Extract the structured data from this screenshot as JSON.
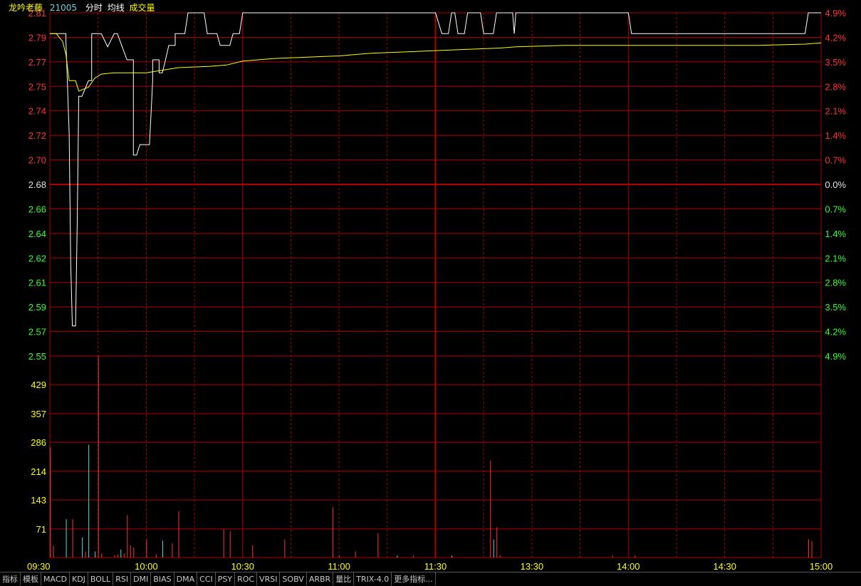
{
  "header": {
    "stock_name": "龙吟老藤",
    "stock_code": "21005",
    "indicator_labels": [
      "分时",
      "均线",
      "成交量"
    ]
  },
  "colors": {
    "up": "#ff3232",
    "down": "#33ff33",
    "flat": "#e0e0e0",
    "price_line": "#ffffff",
    "avg_line": "#ffff00",
    "volume_tick": "#ffff00",
    "cyan": "#5fd7d7",
    "time_label": "#ffff00"
  },
  "chart_data": {
    "type": "line",
    "prev_close": 2.68,
    "ylim": [
      2.549,
      2.812
    ],
    "price_ticks": [
      "2.81",
      "2.79",
      "2.77",
      "2.75",
      "2.74",
      "2.72",
      "2.70",
      "2.68",
      "2.66",
      "2.64",
      "2.62",
      "2.61",
      "2.59",
      "2.57",
      "2.55"
    ],
    "pct_ticks": [
      "4.9%",
      "4.2%",
      "3.5%",
      "2.8%",
      "2.1%",
      "1.4%",
      "0.7%",
      "0.0%",
      "0.7%",
      "1.4%",
      "2.1%",
      "2.8%",
      "3.5%",
      "4.2%",
      "4.9%"
    ],
    "x_labels": [
      "09:30",
      "10:00",
      "10:30",
      "11:00",
      "11:30",
      "13:30",
      "14:00",
      "14:30",
      "15:00"
    ],
    "x_label_minutes": [
      0,
      30,
      60,
      90,
      120,
      150,
      180,
      210,
      240
    ],
    "series": [
      {
        "role": "price",
        "points": [
          [
            0,
            2.796
          ],
          [
            5,
            2.796
          ],
          [
            5,
            2.79
          ],
          [
            6,
            2.72
          ],
          [
            6.5,
            2.62
          ],
          [
            7,
            2.572
          ],
          [
            8,
            2.572
          ],
          [
            8.5,
            2.65
          ],
          [
            9,
            2.748
          ],
          [
            10,
            2.748
          ],
          [
            12,
            2.76
          ],
          [
            13,
            2.76
          ],
          [
            13,
            2.796
          ],
          [
            16,
            2.796
          ],
          [
            18,
            2.786
          ],
          [
            20,
            2.796
          ],
          [
            21,
            2.796
          ],
          [
            24,
            2.776
          ],
          [
            25,
            2.776
          ],
          [
            26,
            2.776
          ],
          [
            26,
            2.703
          ],
          [
            27,
            2.703
          ],
          [
            28,
            2.711
          ],
          [
            31,
            2.711
          ],
          [
            32,
            2.76
          ],
          [
            32,
            2.776
          ],
          [
            34,
            2.776
          ],
          [
            34,
            2.766
          ],
          [
            35,
            2.766
          ],
          [
            36,
            2.776
          ],
          [
            37,
            2.787
          ],
          [
            39,
            2.787
          ],
          [
            39,
            2.796
          ],
          [
            41,
            2.796
          ],
          [
            42,
            2.796
          ],
          [
            43,
            2.812
          ],
          [
            44,
            2.812
          ],
          [
            48,
            2.812
          ],
          [
            49,
            2.796
          ],
          [
            52,
            2.796
          ],
          [
            53,
            2.787
          ],
          [
            56,
            2.787
          ],
          [
            57,
            2.796
          ],
          [
            59,
            2.796
          ],
          [
            60,
            2.812
          ],
          [
            120,
            2.812
          ],
          [
            122,
            2.796
          ],
          [
            124,
            2.796
          ],
          [
            125,
            2.812
          ],
          [
            126,
            2.812
          ],
          [
            127,
            2.796
          ],
          [
            129,
            2.796
          ],
          [
            130,
            2.812
          ],
          [
            134,
            2.812
          ],
          [
            135,
            2.796
          ],
          [
            138,
            2.796
          ],
          [
            139,
            2.812
          ],
          [
            144,
            2.812
          ],
          [
            144.5,
            2.796
          ],
          [
            145,
            2.812
          ],
          [
            180,
            2.812
          ],
          [
            181,
            2.796
          ],
          [
            235,
            2.796
          ],
          [
            236,
            2.812
          ],
          [
            240,
            2.812
          ]
        ]
      },
      {
        "role": "average",
        "points": [
          [
            0,
            2.796
          ],
          [
            2,
            2.796
          ],
          [
            4,
            2.79
          ],
          [
            5,
            2.78
          ],
          [
            6,
            2.76
          ],
          [
            8,
            2.76
          ],
          [
            9,
            2.752
          ],
          [
            12,
            2.755
          ],
          [
            14,
            2.762
          ],
          [
            16,
            2.765
          ],
          [
            20,
            2.766
          ],
          [
            24,
            2.766
          ],
          [
            30,
            2.766
          ],
          [
            35,
            2.768
          ],
          [
            40,
            2.77
          ],
          [
            50,
            2.771
          ],
          [
            55,
            2.772
          ],
          [
            60,
            2.775
          ],
          [
            70,
            2.777
          ],
          [
            80,
            2.778
          ],
          [
            90,
            2.779
          ],
          [
            100,
            2.781
          ],
          [
            110,
            2.782
          ],
          [
            120,
            2.783
          ],
          [
            140,
            2.785
          ],
          [
            145,
            2.786
          ],
          [
            160,
            2.787
          ],
          [
            180,
            2.787
          ],
          [
            200,
            2.787
          ],
          [
            220,
            2.787
          ],
          [
            235,
            2.788
          ],
          [
            240,
            2.789
          ]
        ]
      }
    ],
    "volume_ticks": [
      "429",
      "357",
      "286",
      "214",
      "143",
      "71"
    ],
    "volume_ylim": [
      0,
      500
    ],
    "volume": [
      [
        0,
        274,
        "up"
      ],
      [
        1,
        30,
        "up"
      ],
      [
        5,
        95,
        "down"
      ],
      [
        7,
        95,
        "up"
      ],
      [
        10,
        50,
        "down"
      ],
      [
        11,
        15,
        "up"
      ],
      [
        12,
        280,
        "down"
      ],
      [
        14,
        15,
        "down"
      ],
      [
        15,
        500,
        "up"
      ],
      [
        16,
        10,
        "up"
      ],
      [
        20,
        5,
        "up"
      ],
      [
        21,
        8,
        "up"
      ],
      [
        22,
        20,
        "down"
      ],
      [
        23,
        10,
        "up"
      ],
      [
        24,
        105,
        "up"
      ],
      [
        25,
        30,
        "up"
      ],
      [
        26,
        25,
        "up"
      ],
      [
        30,
        45,
        "up"
      ],
      [
        33,
        8,
        "up"
      ],
      [
        35,
        42,
        "down"
      ],
      [
        38,
        35,
        "up"
      ],
      [
        40,
        115,
        "up"
      ],
      [
        54,
        70,
        "up"
      ],
      [
        56,
        65,
        "up"
      ],
      [
        63,
        30,
        "up"
      ],
      [
        73,
        45,
        "up"
      ],
      [
        88,
        125,
        "up"
      ],
      [
        90,
        5,
        "up"
      ],
      [
        95,
        15,
        "up"
      ],
      [
        102,
        60,
        "up"
      ],
      [
        108,
        5,
        "down"
      ],
      [
        113,
        5,
        "up"
      ],
      [
        125,
        5,
        "down"
      ],
      [
        137,
        240,
        "up"
      ],
      [
        138,
        45,
        "down"
      ],
      [
        139,
        75,
        "up"
      ],
      [
        140,
        5,
        "up"
      ],
      [
        175,
        5,
        "up"
      ],
      [
        182,
        5,
        "up"
      ],
      [
        236,
        45,
        "up"
      ],
      [
        237,
        40,
        "up"
      ]
    ],
    "grid": true
  },
  "toolbar": {
    "tabs": [
      "指标",
      "模板",
      "MACD",
      "KDJ",
      "BOLL",
      "RSI",
      "DMI",
      "BIAS",
      "DMA",
      "CCI",
      "PSY",
      "ROC",
      "VRSI",
      "SOBV",
      "ARBR",
      "量比",
      "TRIX-4.0",
      "更多指标..."
    ]
  }
}
